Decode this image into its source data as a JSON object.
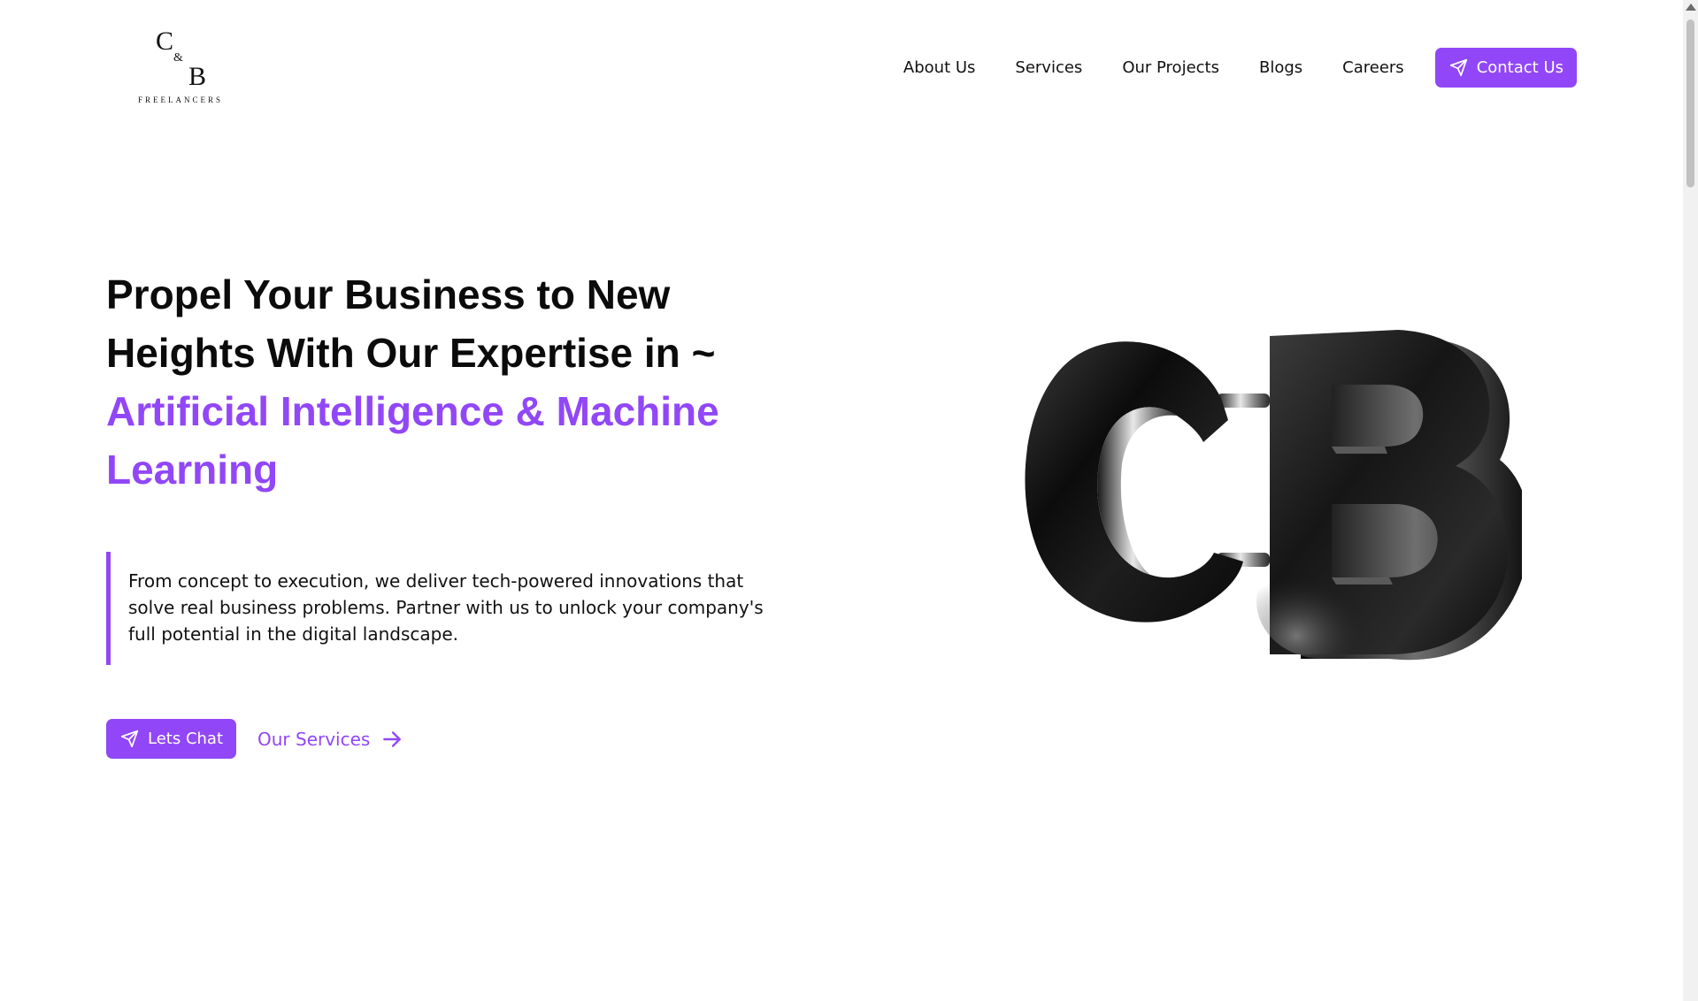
{
  "logo": {
    "c": "C",
    "amp": "&",
    "b": "B",
    "subtitle": "FREELANCERS"
  },
  "nav": {
    "links": [
      "About Us",
      "Services",
      "Our Projects",
      "Blogs",
      "Careers"
    ],
    "contact_label": "Contact Us"
  },
  "hero": {
    "title_line1": "Propel Your Business to New",
    "title_line2": "Heights With Our Expertise in ~",
    "accent_line1": "Artificial Intelligence & Machine",
    "accent_line2": "Learning",
    "description_line1": "From concept to execution, we deliver tech-powered innovations that",
    "description_line2": "solve real business problems. Partner with us to unlock your company's",
    "description_line3": "full potential in the digital landscape.",
    "chat_label": "Lets Chat",
    "services_label": "Our Services"
  },
  "colors": {
    "accent": "#9147f7",
    "text": "#0b0b0b",
    "background": "#ffffff"
  },
  "icons": {
    "contact": "send-icon",
    "chat": "send-icon",
    "services": "arrow-right-icon",
    "hero_graphic": "cb-3d-logo"
  }
}
